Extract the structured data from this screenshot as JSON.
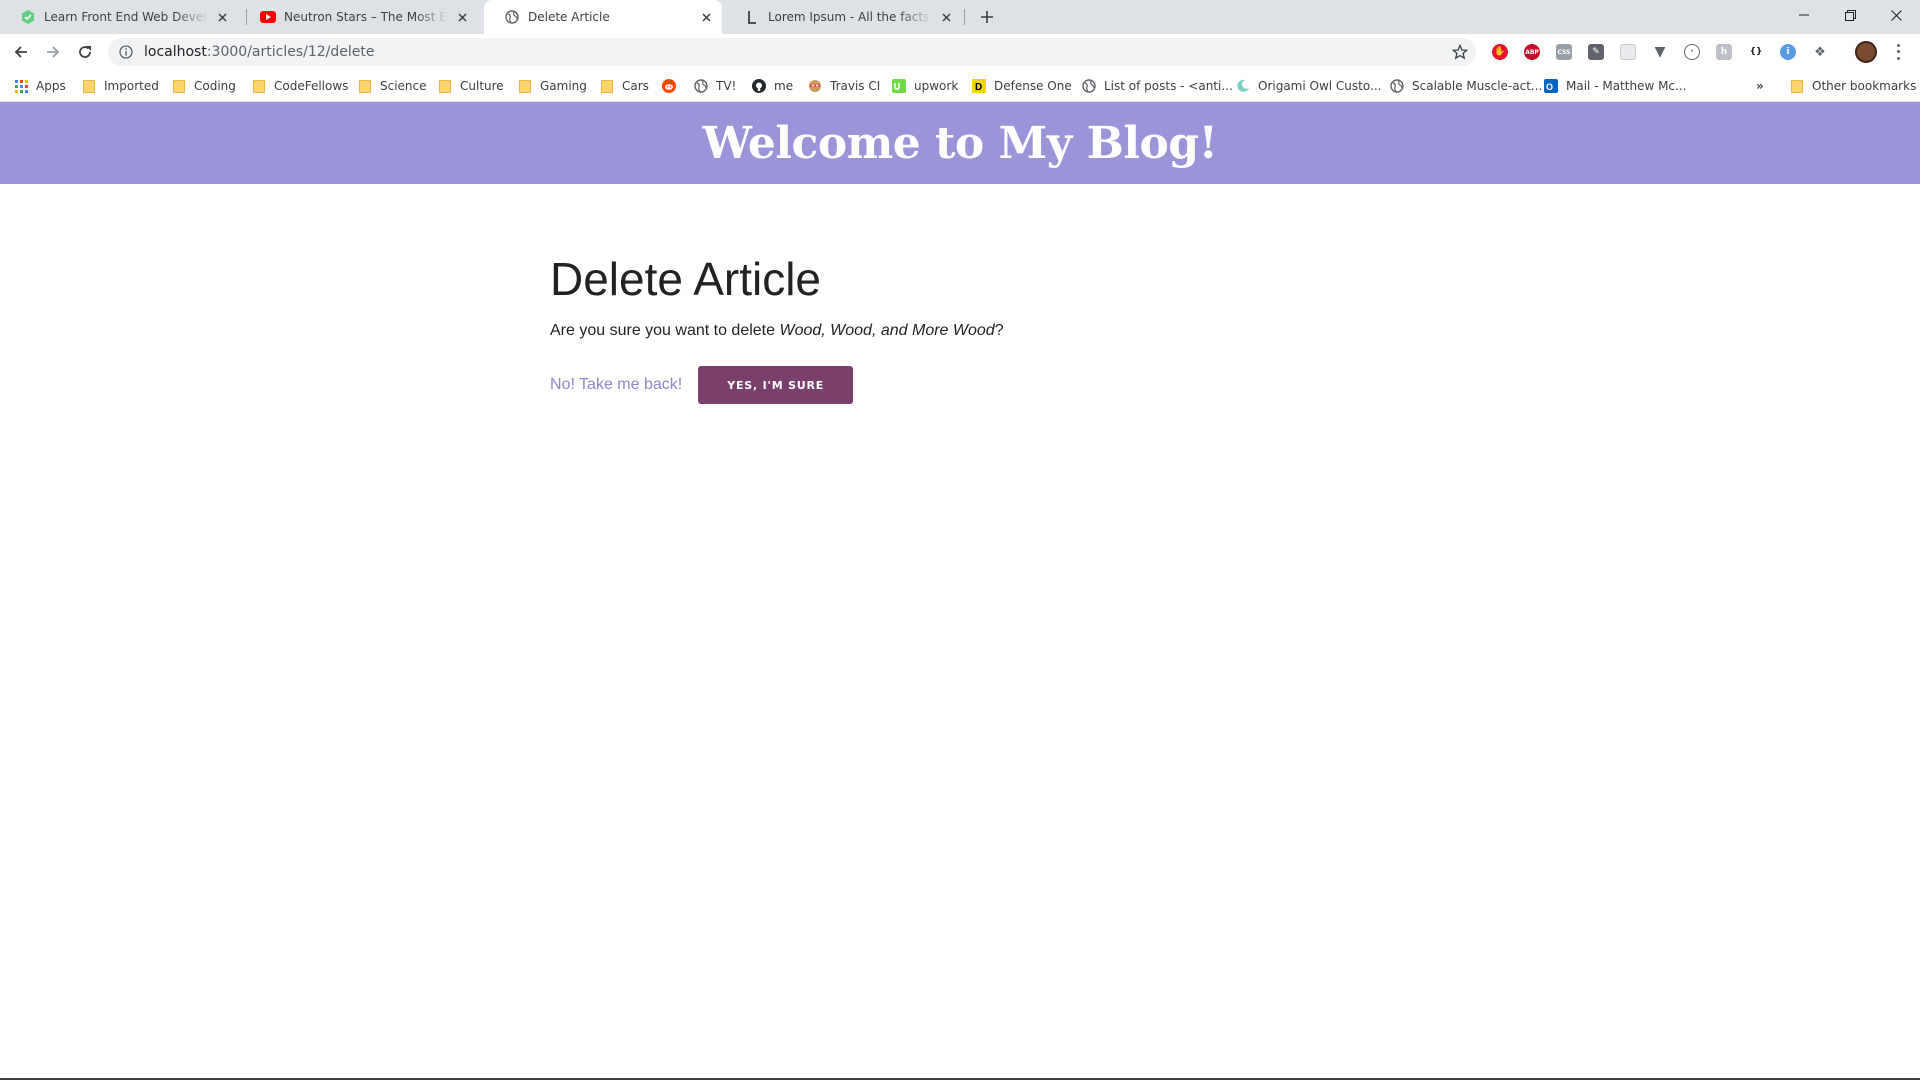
{
  "browser": {
    "tabs": [
      {
        "title": "Learn Front End Web Development",
        "favicon": "treehouse-icon",
        "favicon_color": "#5fcf80"
      },
      {
        "title": "Neutron Stars – The Most Extreme Things",
        "favicon": "youtube-icon",
        "favicon_color": "#ff0000"
      },
      {
        "title": "Delete Article",
        "favicon": "globe-icon",
        "active": true
      },
      {
        "title": "Lorem Ipsum - All the facts - Lipsum",
        "favicon": "lipsum-icon"
      }
    ],
    "url_host": "localhost",
    "url_path": ":3000/articles/12/delete",
    "bookmarks": [
      {
        "label": "Apps",
        "icon": "apps-grid-icon"
      },
      {
        "label": "Imported",
        "icon": "folder-icon"
      },
      {
        "label": "Coding",
        "icon": "folder-icon"
      },
      {
        "label": "CodeFellows",
        "icon": "folder-icon"
      },
      {
        "label": "Science",
        "icon": "folder-icon"
      },
      {
        "label": "Culture",
        "icon": "folder-icon"
      },
      {
        "label": "Gaming",
        "icon": "folder-icon"
      },
      {
        "label": "Cars",
        "icon": "folder-icon"
      },
      {
        "label": "",
        "icon": "reddit-icon"
      },
      {
        "label": "TV!",
        "icon": "globe-icon"
      },
      {
        "label": "me",
        "icon": "github-icon"
      },
      {
        "label": "Travis CI",
        "icon": "travis-icon"
      },
      {
        "label": "upwork",
        "icon": "upwork-icon"
      },
      {
        "label": "Defense One",
        "icon": "defense-one-icon"
      },
      {
        "label": "List of posts - <anti...",
        "icon": "globe-icon"
      },
      {
        "label": "Origami Owl Custo...",
        "icon": "origami-owl-icon"
      },
      {
        "label": "Scalable Muscle-act...",
        "icon": "globe-icon"
      },
      {
        "label": "Mail - Matthew Mc...",
        "icon": "outlook-icon"
      }
    ],
    "overflow_label": "»",
    "other_bookmarks": "Other bookmarks"
  },
  "site": {
    "title": "Welcome to My Blog!",
    "header_color": "#9b94d9"
  },
  "delete_page": {
    "heading": "Delete Article",
    "prompt_prefix": "Are you sure you want to delete ",
    "article_title": "Wood, Wood, and More Wood",
    "prompt_suffix": "?",
    "back_label": "No! Take me back!",
    "confirm_label": "YES, I'M SURE",
    "confirm_color": "#7b3f6e",
    "link_color": "#8f86cf"
  }
}
